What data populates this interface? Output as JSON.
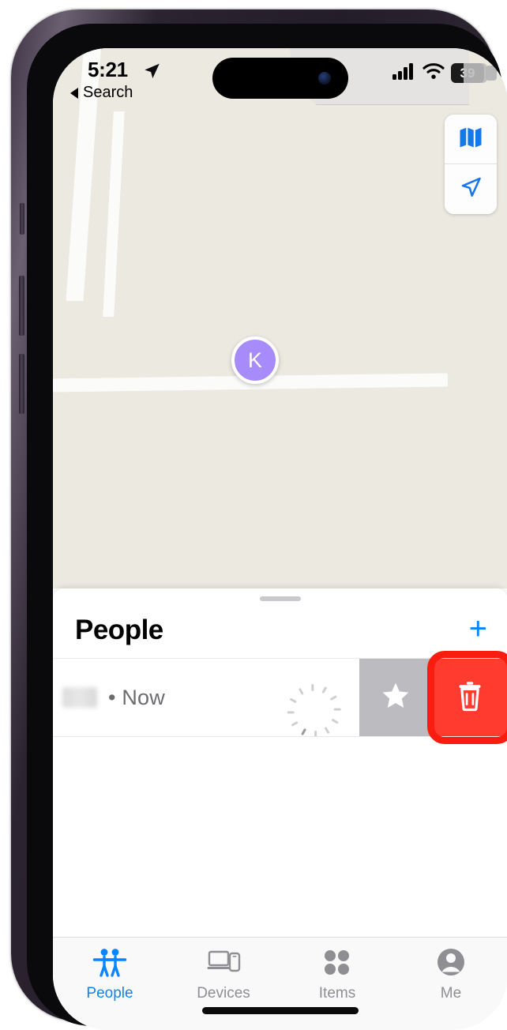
{
  "status_bar": {
    "time": "5:21",
    "location_icon": "location-arrow-icon",
    "cellular_icon": "signal-bars-icon",
    "wifi_icon": "wifi-icon",
    "battery_percent": "39"
  },
  "back_link": {
    "label": "Search",
    "icon": "back-chevron-icon"
  },
  "map": {
    "background_color": "#ece9e1",
    "road_color": "#fbfbf9",
    "controls": [
      {
        "name": "map-type-button",
        "icon": "folded-map-icon",
        "color": "#1677e8"
      },
      {
        "name": "locate-me-button",
        "icon": "navigation-arrow-icon",
        "color": "#1677e8"
      }
    ],
    "marker": {
      "initial": "K",
      "color": "#a78bfa"
    }
  },
  "sheet": {
    "title": "People",
    "add_button_label": "+",
    "add_button_color": "#0a84ff",
    "row": {
      "name": "",
      "name_redacted": true,
      "subtitle": "• Now",
      "spinner_icon": "loading-spinner-icon",
      "actions": [
        {
          "name": "favorite-action",
          "icon": "star-icon",
          "background": "#bcbcc0"
        },
        {
          "name": "delete-action",
          "icon": "trash-icon",
          "background": "#ff3b30"
        }
      ]
    }
  },
  "annotation": {
    "target": "delete-action",
    "color": "#f91d10"
  },
  "tab_bar": {
    "items": [
      {
        "label": "People",
        "icon": "people-icon",
        "active": true
      },
      {
        "label": "Devices",
        "icon": "devices-icon",
        "active": false
      },
      {
        "label": "Items",
        "icon": "items-grid-icon",
        "active": false
      },
      {
        "label": "Me",
        "icon": "person-circle-icon",
        "active": false
      }
    ],
    "active_color": "#0a84ff",
    "inactive_color": "#8e8e93"
  }
}
